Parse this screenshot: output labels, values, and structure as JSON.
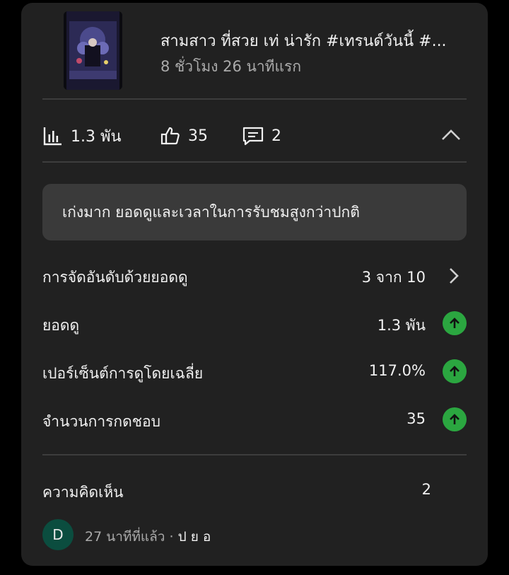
{
  "video": {
    "title": "สามสาว ที่สวย เท่ น่ารัก #เทรนด์วันนี้ #...",
    "subtitle": "8 ชั่วโมง 26 นาทีแรก"
  },
  "stats": {
    "views": "1.3 พัน",
    "likes": "35",
    "comments": "2"
  },
  "banner": {
    "text": "เก่งมาก ยอดดูและเวลาในการรับชมสูงกว่าปกติ"
  },
  "metrics": [
    {
      "label": "การจัดอันดับด้วยยอดดู",
      "value": "3 จาก 10",
      "icon": "chevron-right-icon"
    },
    {
      "label": "ยอดดู",
      "value": "1.3 พัน",
      "icon": "arrow-up-icon"
    },
    {
      "label": "เปอร์เซ็นต์การดูโดยเฉลี่ย",
      "value": "117.0%",
      "icon": "arrow-up-icon"
    },
    {
      "label": "จำนวนการกดชอบ",
      "value": "35",
      "icon": "arrow-up-icon"
    }
  ],
  "comments_section": {
    "label": "ความคิดเห็น",
    "count": "2",
    "latest": {
      "avatar_initial": "D",
      "time": "27 นาทีที่แล้ว",
      "separator": " · ",
      "author": "ป ย อ"
    }
  },
  "colors": {
    "card_bg": "#212121",
    "banner_bg": "#3a3a3a",
    "up_badge": "#2ba640",
    "avatar_bg": "#0b4d3f"
  }
}
